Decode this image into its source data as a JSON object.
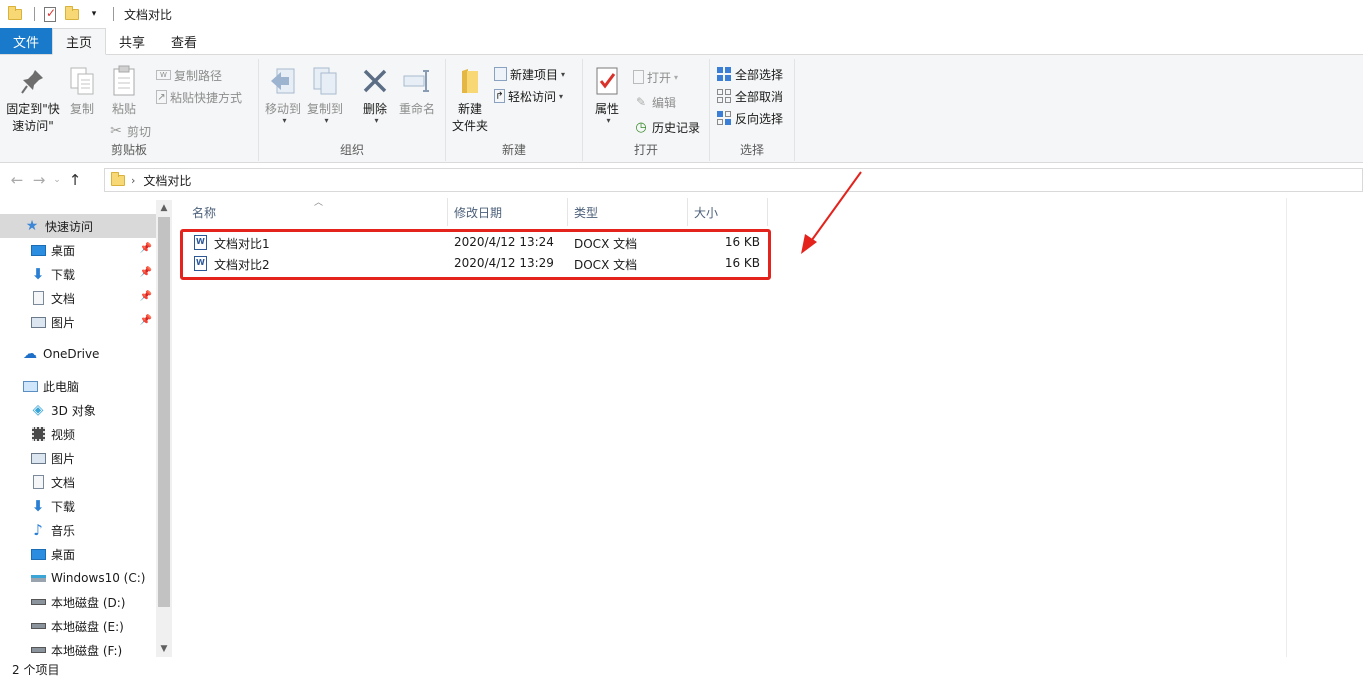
{
  "window": {
    "title": "文档对比"
  },
  "tabs": [
    {
      "label": "文件",
      "kind": "file"
    },
    {
      "label": "主页",
      "kind": "active"
    },
    {
      "label": "共享",
      "kind": "normal"
    },
    {
      "label": "查看",
      "kind": "normal"
    }
  ],
  "ribbon": {
    "clipboard": {
      "label": "剪贴板",
      "pin_line1": "固定到\"快",
      "pin_line2": "速访问\"",
      "copy": "复制",
      "paste": "粘贴",
      "copy_path": "复制路径",
      "paste_shortcut": "粘贴快捷方式",
      "cut": "剪切"
    },
    "organize": {
      "label": "组织",
      "move_to": "移动到",
      "copy_to": "复制到",
      "delete": "删除",
      "rename": "重命名"
    },
    "new": {
      "label": "新建",
      "new_folder_line1": "新建",
      "new_folder_line2": "文件夹",
      "new_item": "新建项目",
      "easy_access": "轻松访问"
    },
    "open": {
      "label": "打开",
      "properties": "属性",
      "open": "打开",
      "edit": "编辑",
      "history": "历史记录"
    },
    "select": {
      "label": "选择",
      "select_all": "全部选择",
      "select_none": "全部取消",
      "invert": "反向选择"
    }
  },
  "address": {
    "crumb": "文档对比"
  },
  "nav": {
    "quick_access": "快速访问",
    "qa_items": [
      "桌面",
      "下载",
      "文档",
      "图片"
    ],
    "onedrive": "OneDrive",
    "this_pc": "此电脑",
    "pc_items": [
      "3D 对象",
      "视频",
      "图片",
      "文档",
      "下载",
      "音乐",
      "桌面",
      "Windows10 (C:)",
      "本地磁盘 (D:)",
      "本地磁盘 (E:)",
      "本地磁盘 (F:)"
    ]
  },
  "columns": {
    "name": "名称",
    "date": "修改日期",
    "type": "类型",
    "size": "大小"
  },
  "files": [
    {
      "name": "文档对比1",
      "date": "2020/4/12 13:24",
      "type": "DOCX 文档",
      "size": "16 KB"
    },
    {
      "name": "文档对比2",
      "date": "2020/4/12 13:29",
      "type": "DOCX 文档",
      "size": "16 KB"
    }
  ],
  "status": {
    "count": "2 个项目"
  },
  "colors": {
    "file_tab": "#1979ca",
    "highlight": "#e3231c",
    "folder": "#f8d775"
  }
}
